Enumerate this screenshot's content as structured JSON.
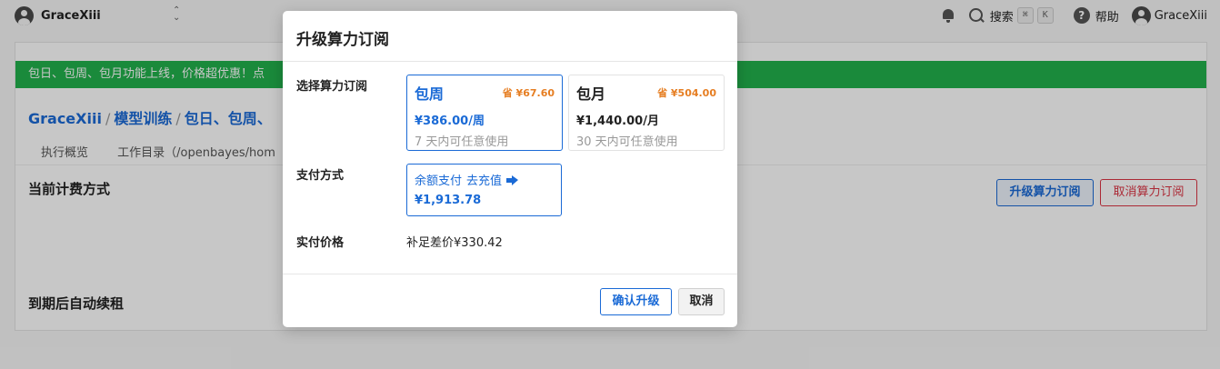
{
  "topbar": {
    "workspace_name": "GraceXiii",
    "search_label": "搜索",
    "search_key_cmd": "⌘",
    "search_key_k": "K",
    "help_label": "帮助",
    "user_name": "GraceXiii"
  },
  "page": {
    "banner_text": "包日、包周、包月功能上线，价格超优惠！点",
    "breadcrumb": [
      "GraceXiii",
      "模型训练",
      "包日、包周、"
    ],
    "breadcrumb_sep": "/",
    "tabs": [
      "执行概览",
      "工作目录（/openbayes/hom"
    ],
    "section_billing": "当前计费方式",
    "section_autorenew": "到期后自动续租",
    "upgrade_button": "升级算力订阅",
    "cancel_button": "取消算力订阅"
  },
  "modal": {
    "title": "升级算力订阅",
    "plan_label": "选择算力订阅",
    "plans": [
      {
        "name": "包周",
        "save": "省 ¥67.60",
        "price": "¥386.00/周",
        "note": "7 天内可任意使用",
        "selected": true
      },
      {
        "name": "包月",
        "save": "省 ¥504.00",
        "price": "¥1,440.00/月",
        "note": "30 天内可任意使用",
        "selected": false
      }
    ],
    "payment_label": "支付方式",
    "payment": {
      "method": "余额支付",
      "recharge_link": "去充值",
      "balance": "¥1,913.78"
    },
    "final_price_label": "实付价格",
    "final_price_value": "补足差价¥330.42",
    "confirm_button": "确认升级",
    "cancel_button": "取消"
  },
  "colors": {
    "primary": "#1a6ad6",
    "banner_green": "#22b14c",
    "save_orange": "#e67e22",
    "danger": "#dc3545"
  }
}
